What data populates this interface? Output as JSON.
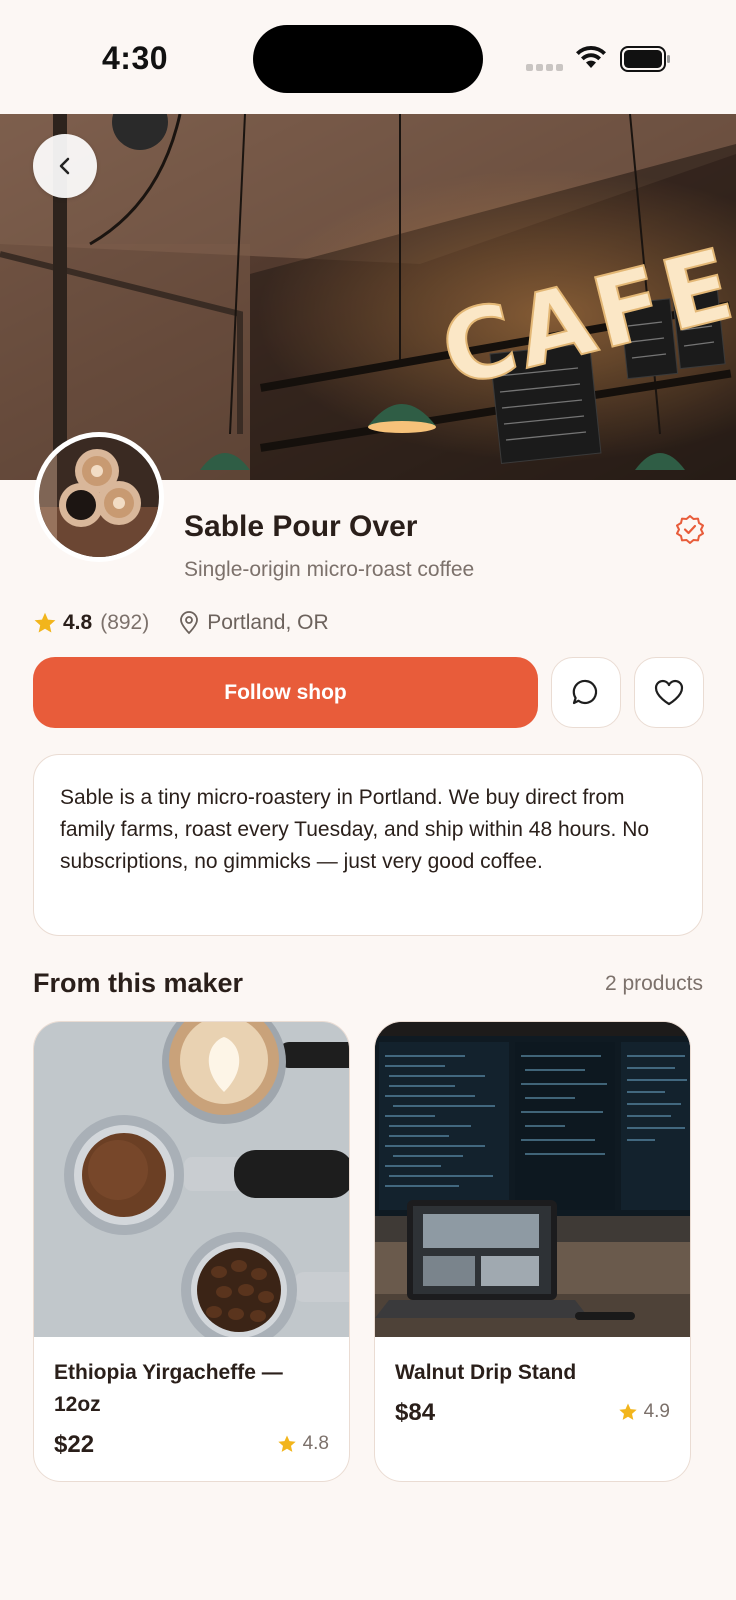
{
  "status_bar": {
    "time": "4:30"
  },
  "shop": {
    "name": "Sable Pour Over",
    "tagline": "Single-origin micro-roast coffee",
    "rating": "4.8",
    "rating_count": "(892)",
    "location": "Portland, OR",
    "hero_sign": "CAFE"
  },
  "actions": {
    "follow_label": "Follow shop"
  },
  "about": {
    "text": "Sable is a tiny micro-roastery in Portland. We buy direct from family farms, roast every Tuesday, and ship within 48 hours. No subscriptions, no gimmicks — just very good coffee."
  },
  "section": {
    "title": "From this maker",
    "count": "2 products"
  },
  "products": [
    {
      "name": "Ethiopia Yirgacheffe — 12oz",
      "price": "$22",
      "rating": "4.8"
    },
    {
      "name": "Walnut Drip Stand",
      "price": "$84",
      "rating": "4.9"
    }
  ],
  "colors": {
    "accent": "#e85c3a",
    "background": "#fcf7f4",
    "star": "#f2b51c",
    "border": "#eadcd3"
  },
  "icons": [
    "chevron-left-icon",
    "verified-badge-icon",
    "star-icon",
    "location-pin-icon",
    "chat-bubble-icon",
    "heart-icon",
    "wifi-icon",
    "battery-icon"
  ]
}
